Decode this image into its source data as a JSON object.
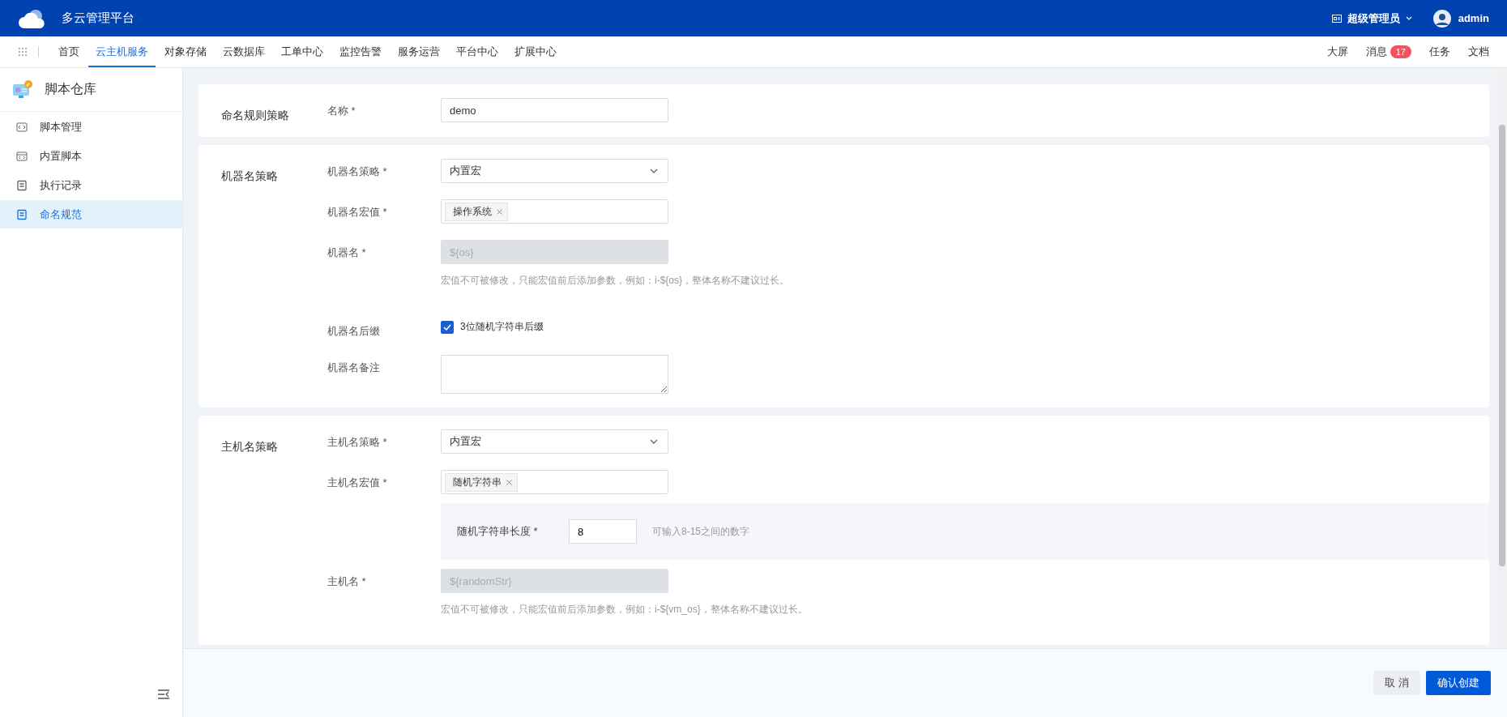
{
  "header": {
    "title": "多云管理平台",
    "role": "超级管理员",
    "user": "admin"
  },
  "nav": {
    "items": [
      {
        "label": "首页",
        "selected": false
      },
      {
        "label": "云主机服务",
        "selected": true
      },
      {
        "label": "对象存储",
        "selected": false
      },
      {
        "label": "云数据库",
        "selected": false
      },
      {
        "label": "工单中心",
        "selected": false
      },
      {
        "label": "监控告警",
        "selected": false
      },
      {
        "label": "服务运营",
        "selected": false
      },
      {
        "label": "平台中心",
        "selected": false
      },
      {
        "label": "扩展中心",
        "selected": false
      }
    ],
    "right": [
      {
        "label": "大屏"
      },
      {
        "label": "消息",
        "badge": "17"
      },
      {
        "label": "任务"
      },
      {
        "label": "文档"
      }
    ]
  },
  "sidebar": {
    "title": "脚本仓库",
    "items": [
      {
        "label": "脚本管理",
        "kind": "code",
        "selected": false
      },
      {
        "label": "内置脚本",
        "kind": "codebox",
        "selected": false
      },
      {
        "label": "执行记录",
        "kind": "doc",
        "selected": false
      },
      {
        "label": "命名规范",
        "kind": "doc",
        "selected": true
      }
    ]
  },
  "sections": [
    {
      "title": "命名规则策略",
      "fields": [
        {
          "kind": "input",
          "label": "名称 *",
          "value": "demo"
        }
      ]
    },
    {
      "title": "机器名策略",
      "fields": [
        {
          "kind": "select",
          "label": "机器名策略 *",
          "value": "内置宏"
        },
        {
          "kind": "tags",
          "label": "机器名宏值 *",
          "tags": [
            "操作系统"
          ]
        },
        {
          "kind": "disabled",
          "label": "机器名 *",
          "placeholder": "${os}",
          "hint": "宏值不可被修改，只能宏值前后添加参数，例如：i-${os}，整体名称不建议过长。"
        },
        {
          "kind": "checkbox",
          "label": "机器名后缀",
          "text": "3位随机字符串后缀",
          "checked": true
        },
        {
          "kind": "textarea",
          "label": "机器名备注"
        }
      ]
    },
    {
      "title": "主机名策略",
      "fields": [
        {
          "kind": "select",
          "label": "主机名策略 *",
          "value": "内置宏"
        },
        {
          "kind": "tags",
          "label": "主机名宏值 *",
          "tags": [
            "随机字符串"
          ]
        },
        {
          "kind": "panel",
          "label": "随机字符串长度 *",
          "value": "8",
          "hint": "可输入8-15之间的数字"
        },
        {
          "kind": "disabled",
          "label": "主机名 *",
          "placeholder": "${randomStr}",
          "hint": "宏值不可被修改，只能宏值前后添加参数，例如：i-${vm_os}，整体名称不建议过长。"
        }
      ]
    }
  ],
  "footer": {
    "cancel": "取 消",
    "confirm": "确认创建"
  }
}
